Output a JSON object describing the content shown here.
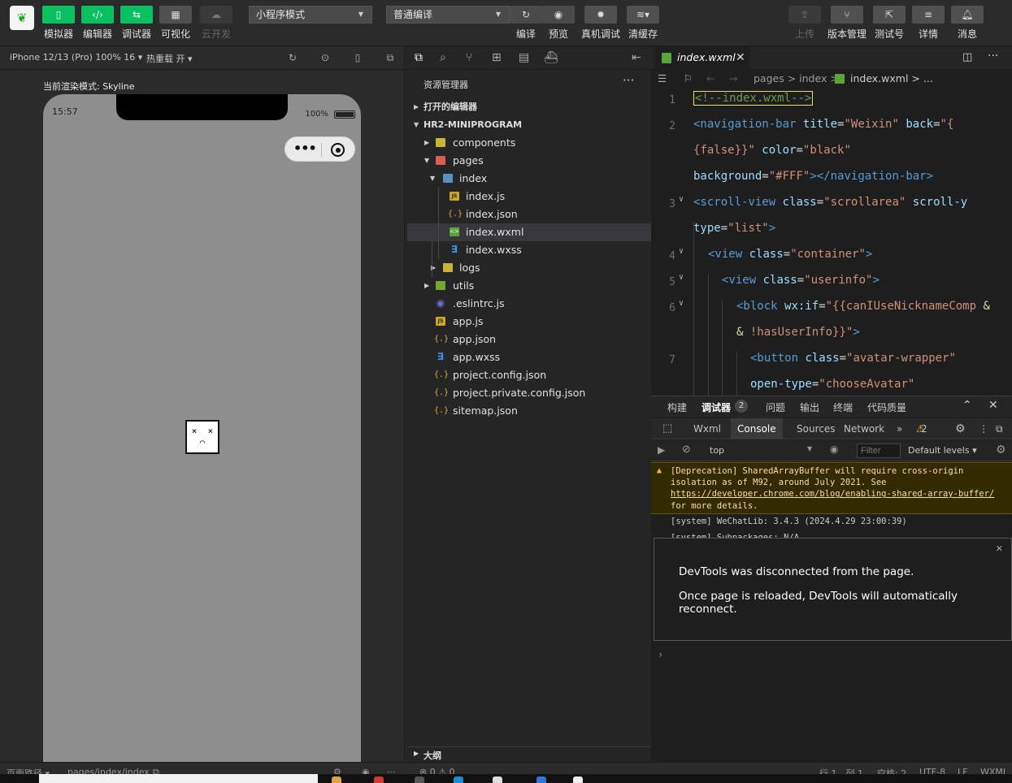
{
  "toolbar": {
    "simulator": "模拟器",
    "editor": "编辑器",
    "debugger": "调试器",
    "visual": "可视化",
    "cloud": "云开发",
    "mode_select": "小程序模式",
    "compile_select": "普通编译",
    "compile": "编译",
    "preview": "预览",
    "device_debug": "真机调试",
    "clear_cache": "清缓存",
    "upload": "上传",
    "version": "版本管理",
    "test_account": "测试号",
    "details": "详情",
    "messages": "消息"
  },
  "subbar": {
    "device": "iPhone 12/13 (Pro) 100% 16 ▾",
    "hot_reload": "热重载 开 ▾"
  },
  "simulator": {
    "render_mode": "当前渲染模式: Skyline",
    "time": "15:57",
    "battery": "100%",
    "sad_face": "×_×"
  },
  "explorer": {
    "title": "资源管理器",
    "open_editors": "打开的编辑器",
    "project": "HR2-MINIPROGRAM",
    "tree": {
      "components": "components",
      "pages": "pages",
      "index": "index",
      "index_js": "index.js",
      "index_json": "index.json",
      "index_wxml": "index.wxml",
      "index_wxss": "index.wxss",
      "logs": "logs",
      "utils": "utils",
      "eslintrc": ".eslintrc.js",
      "app_js": "app.js",
      "app_json": "app.json",
      "app_wxss": "app.wxss",
      "project_config": "project.config.json",
      "project_private": "project.private.config.json",
      "sitemap": "sitemap.json"
    },
    "outline": "大纲"
  },
  "editor": {
    "tab": "index.wxml",
    "crumbs": "pages > index > ",
    "crumb_file": "index.wxml > ...",
    "line_numbers": [
      "1",
      "2",
      "3",
      "4",
      "5",
      "6",
      "7"
    ]
  },
  "debug": {
    "tabs": {
      "build": "构建",
      "debugger": "调试器",
      "badge": "2",
      "issues": "问题",
      "output": "输出",
      "terminal": "终端",
      "quality": "代码质量"
    },
    "devtools": {
      "wxml": "Wxml",
      "console": "Console",
      "sources": "Sources",
      "network": "Network",
      "warn_count": "2"
    },
    "filter": {
      "context": "top",
      "placeholder": "Filter",
      "levels": "Default levels ▾"
    },
    "console": {
      "warn_text": "[Deprecation] SharedArrayBuffer will require cross-origin isolation as of M92, around July 2021. See ",
      "warn_link": "https://developer.chrome.com/blog/enabling-shared-array-buffer/",
      "warn_tail": " for more details.",
      "sys1": "[system] WeChatLib: 3.4.3 (2024.4.29 23:00:39)",
      "sys2": "[system] Subpackages: N/A",
      "overlay_line1": "DevTools was disconnected from the page.",
      "overlay_line2": "Once page is reloaded, DevTools will automatically reconnect."
    }
  },
  "statusbar": {
    "page_path": "页面路径 ▾",
    "path_value": "pages/index/index",
    "errors": "⊗ 0 ⚠ 0",
    "row": "行 1，列 1",
    "spaces": "空格: 2",
    "encoding": "UTF-8",
    "eol": "LF",
    "lang": "WXML"
  }
}
